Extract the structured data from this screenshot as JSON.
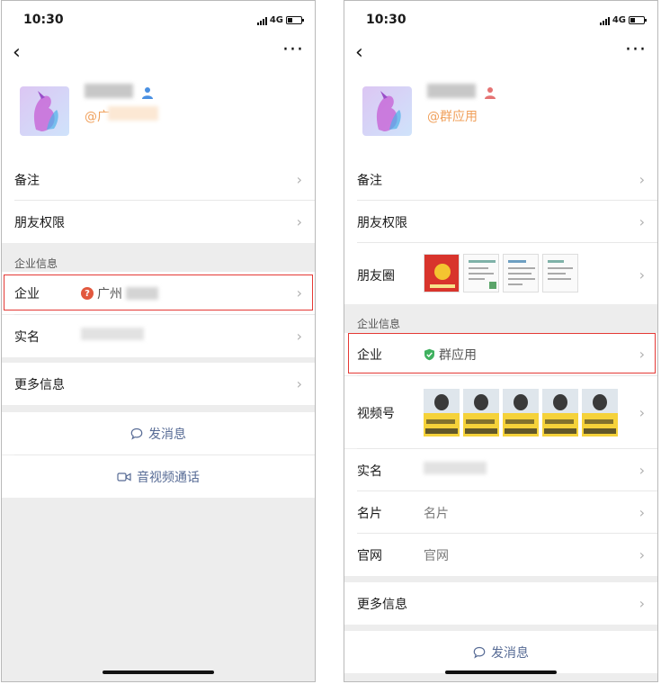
{
  "status": {
    "time": "10:30",
    "network": "4G"
  },
  "left": {
    "corp_prefix": "@广",
    "rows": {
      "remark": "备注",
      "friend_perm": "朋友权限",
      "section": "企业信息",
      "company": "企业",
      "company_value": "广州",
      "realname": "实名",
      "more_info": "更多信息"
    },
    "actions": {
      "message": "发消息",
      "call": "音视频通话"
    }
  },
  "right": {
    "corp_prefix": "@群应用",
    "rows": {
      "remark": "备注",
      "friend_perm": "朋友权限",
      "moments": "朋友圈",
      "section": "企业信息",
      "company": "企业",
      "company_value": "群应用",
      "channel": "视频号",
      "realname": "实名",
      "card": "名片",
      "card_value": "名片",
      "website": "官网",
      "website_value": "官网",
      "more_info": "更多信息"
    },
    "actions": {
      "message": "发消息"
    }
  },
  "colors": {
    "link": "#576b95",
    "highlight": "#e53935",
    "corp": "#f0a05b",
    "verified": "#3fb15f",
    "warning": "#e2583e"
  }
}
